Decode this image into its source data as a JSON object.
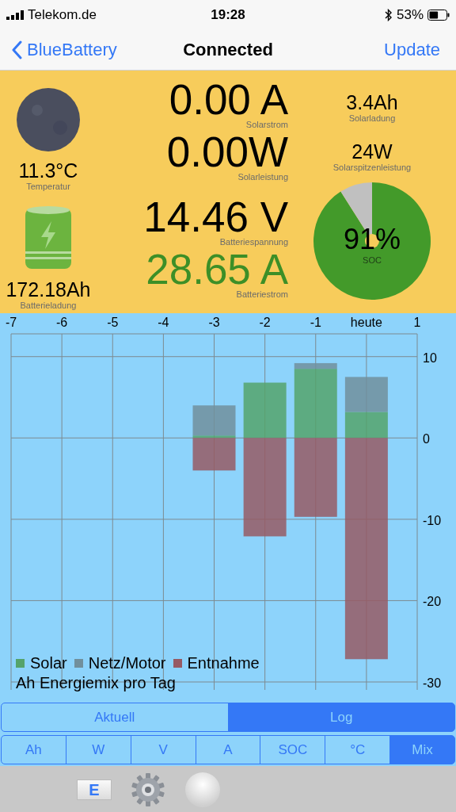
{
  "status_bar": {
    "carrier": "Telekom.de",
    "time": "19:28",
    "battery_percent": "53%"
  },
  "nav": {
    "back": "BlueBattery",
    "title": "Connected",
    "action": "Update"
  },
  "panel": {
    "temperature": {
      "value": "11.3°C",
      "label": "Temperatur"
    },
    "battery_charge": {
      "value": "172.18Ah",
      "label": "Batterieladung"
    },
    "readings": [
      {
        "value": "0.00 A",
        "label": "Solarstrom",
        "color": "#000000"
      },
      {
        "value": "0.00W",
        "label": "Solarleistung",
        "color": "#000000"
      },
      {
        "value": "14.46 V",
        "label": "Batteriespannung",
        "color": "#000000"
      },
      {
        "value": "28.65 A",
        "label": "Batteriestrom",
        "color": "#3d8f27"
      }
    ],
    "side": [
      {
        "value": "3.4Ah",
        "label": "Solarladung"
      },
      {
        "value": "24W",
        "label": "Solarspitzenleistung"
      }
    ],
    "soc": {
      "value": "91%",
      "label": "SOC"
    }
  },
  "chart": {
    "chart_data": {
      "type": "bar",
      "stacked": true,
      "title": "Ah Energiemix pro Tag",
      "x": [
        -3,
        -2,
        -1,
        0
      ],
      "xlim": [
        -7,
        1
      ],
      "xticks": [
        -7,
        -6,
        -5,
        -4,
        -3,
        -2,
        -1,
        {
          "value": 0,
          "label": "heute"
        },
        1
      ],
      "ylim": [
        -30,
        12.8
      ],
      "yticks": [
        -30,
        -20,
        -10,
        0,
        10
      ],
      "grid": true,
      "legend": true,
      "series": [
        {
          "name": "Solar",
          "color": "#55a36b",
          "values": [
            0.3,
            6.8,
            8.5,
            3.2
          ]
        },
        {
          "name": "Netz/Motor",
          "color": "#718f9c",
          "values": [
            3.7,
            0,
            0.7,
            4.3
          ]
        },
        {
          "name": "Entnahme",
          "color": "#965a64",
          "values": [
            -4.0,
            -12.1,
            -9.7,
            -27.2
          ]
        }
      ]
    }
  },
  "mode_tabs": [
    {
      "label": "Aktuell",
      "selected": false
    },
    {
      "label": "Log",
      "selected": true
    }
  ],
  "unit_tabs": [
    {
      "label": "Ah",
      "selected": false
    },
    {
      "label": "W",
      "selected": false
    },
    {
      "label": "V",
      "selected": false
    },
    {
      "label": "A",
      "selected": false
    },
    {
      "label": "SOC",
      "selected": false
    },
    {
      "label": "°C",
      "selected": false
    },
    {
      "label": "Mix",
      "selected": true
    }
  ],
  "toolbar": {
    "mail_letter": "E"
  }
}
